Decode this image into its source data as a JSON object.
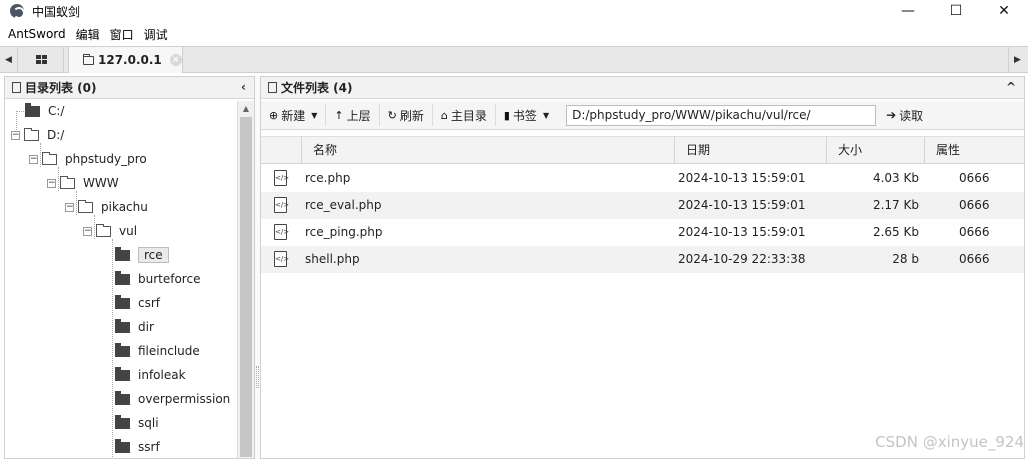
{
  "window": {
    "title": "中国蚁剑",
    "minimize": "—",
    "maximize": "☐",
    "close": "✕"
  },
  "menu": [
    "AntSword",
    "编辑",
    "窗口",
    "调试"
  ],
  "tabs": {
    "scroll_left": "◀",
    "scroll_right": "▶",
    "active_label": "127.0.0.1",
    "close_glyph": "×"
  },
  "dir_panel": {
    "title": "目录列表 (0)",
    "collapse": "‹"
  },
  "tree": [
    {
      "label": "C:/",
      "icon": "folder-solid"
    },
    {
      "label": "D:/",
      "icon": "folder-open",
      "toggle": "−"
    },
    {
      "label": "phpstudy_pro",
      "icon": "folder-open",
      "toggle": "−"
    },
    {
      "label": "WWW",
      "icon": "folder-open",
      "toggle": "−"
    },
    {
      "label": "pikachu",
      "icon": "folder-open",
      "toggle": "−"
    },
    {
      "label": "vul",
      "icon": "folder-open",
      "toggle": "−"
    },
    {
      "label": "rce",
      "icon": "folder-solid",
      "selected": true
    },
    {
      "label": "burteforce",
      "icon": "folder-solid"
    },
    {
      "label": "csrf",
      "icon": "folder-solid"
    },
    {
      "label": "dir",
      "icon": "folder-solid"
    },
    {
      "label": "fileinclude",
      "icon": "folder-solid"
    },
    {
      "label": "infoleak",
      "icon": "folder-solid"
    },
    {
      "label": "overpermission",
      "icon": "folder-solid"
    },
    {
      "label": "sqli",
      "icon": "folder-solid"
    },
    {
      "label": "ssrf",
      "icon": "folder-solid"
    }
  ],
  "file_panel": {
    "title": "文件列表 (4)",
    "collapse": "^"
  },
  "toolbar": {
    "new_label": "新建",
    "up_label": "上层",
    "refresh_label": "刷新",
    "home_label": "主目录",
    "bookmark_label": "书签",
    "path_value": "D:/phpstudy_pro/WWW/pikachu/vul/rce/",
    "read_label": "读取"
  },
  "columns": [
    "名称",
    "日期",
    "大小",
    "属性"
  ],
  "files": [
    {
      "name": "rce.php",
      "date": "2024-10-13 15:59:01",
      "size": "4.03 Kb",
      "attr": "0666"
    },
    {
      "name": "rce_eval.php",
      "date": "2024-10-13 15:59:01",
      "size": "2.17 Kb",
      "attr": "0666"
    },
    {
      "name": "rce_ping.php",
      "date": "2024-10-13 15:59:01",
      "size": "2.65 Kb",
      "attr": "0666"
    },
    {
      "name": "shell.php",
      "date": "2024-10-29 22:33:38",
      "size": "28 b",
      "attr": "0666"
    }
  ],
  "watermark": "CSDN @xinyue_924"
}
